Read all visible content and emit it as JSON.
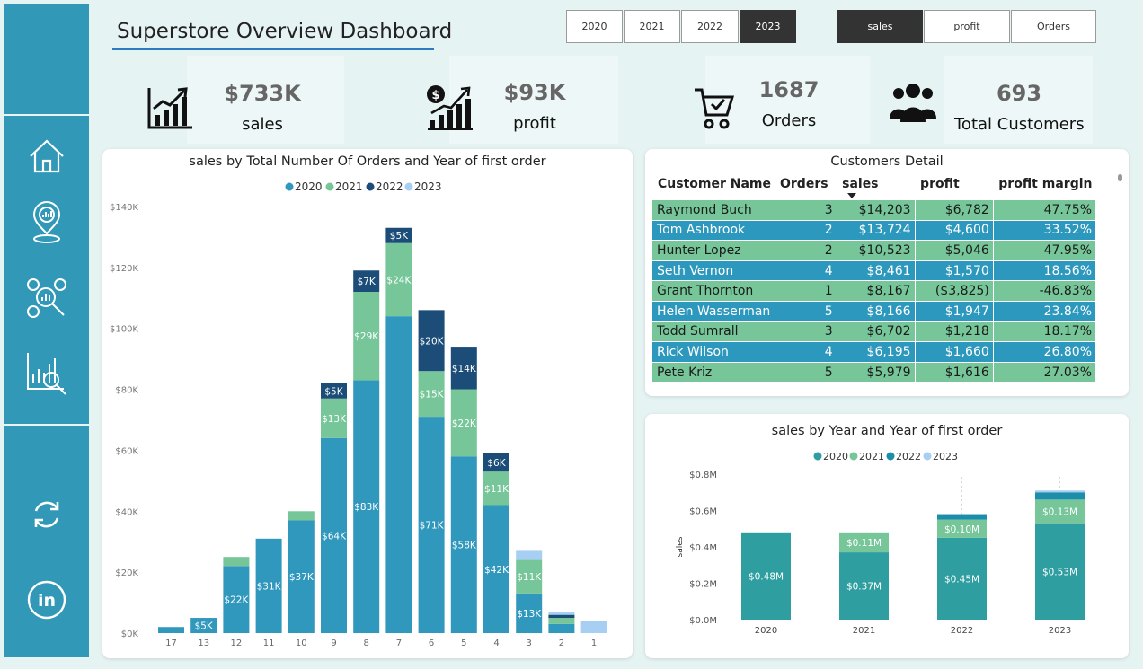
{
  "header": {
    "title": "Superstore Overview Dashboard"
  },
  "year_filter": [
    {
      "label": "2020",
      "selected": false
    },
    {
      "label": "2021",
      "selected": false
    },
    {
      "label": "2022",
      "selected": false
    },
    {
      "label": "2023",
      "selected": true
    }
  ],
  "measure_filter": [
    {
      "label": "sales",
      "selected": true
    },
    {
      "label": "profit",
      "selected": false
    },
    {
      "label": "Orders",
      "selected": false
    }
  ],
  "kpis": {
    "sales": {
      "value": "$733K",
      "label": "sales"
    },
    "profit": {
      "value": "$93K",
      "label": "profit"
    },
    "orders": {
      "value": "1687",
      "label": "Orders"
    },
    "customers": {
      "value": "693",
      "label": "Total Customers"
    }
  },
  "icons": {
    "home": "home-icon",
    "map": "map-pin-icon",
    "customers": "customer-analysis-icon",
    "report": "report-search-icon",
    "refresh": "refresh-icon",
    "linkedin": "linkedin-icon"
  },
  "colors": {
    "2020": "#3198bd",
    "2021": "#76c69a",
    "2022": "#1c4d78",
    "2023": "#a7cff3",
    "y2020_small": "#2f9ea0",
    "y2022_small": "#1d8eaa",
    "sidebar": "#3198b8"
  },
  "chart_main": {
    "title": "sales by Total Number Of Orders and Year of first order",
    "legend": [
      "2020",
      "2021",
      "2022",
      "2023"
    ],
    "y_ticks": [
      "$0K",
      "$20K",
      "$40K",
      "$60K",
      "$80K",
      "$100K",
      "$120K",
      "$140K"
    ],
    "ylim": [
      0,
      140
    ]
  },
  "chart_small": {
    "title": "sales by Year and Year of first order",
    "legend": [
      "2020",
      "2021",
      "2022",
      "2023"
    ],
    "ylabel": "sales",
    "y_ticks": [
      "$0.0M",
      "$0.2M",
      "$0.4M",
      "$0.6M",
      "$0.8M"
    ],
    "ylim": [
      0,
      0.8
    ]
  },
  "chart_data": [
    {
      "type": "bar",
      "stacked": true,
      "title": "sales by Total Number Of Orders and Year of first order",
      "xlabel": "",
      "ylabel": "",
      "ylim": [
        0,
        140
      ],
      "grid": false,
      "legend_position": "top",
      "categories": [
        "17",
        "13",
        "12",
        "11",
        "10",
        "9",
        "8",
        "7",
        "6",
        "5",
        "4",
        "3",
        "2",
        "1"
      ],
      "series": [
        {
          "name": "2020",
          "values": [
            2,
            5,
            22,
            31,
            37,
            64,
            83,
            104,
            71,
            58,
            42,
            13,
            3,
            0
          ],
          "labels": [
            "",
            "$5K",
            "$22K",
            "$31K",
            "$37K",
            "$64K",
            "$83K",
            "",
            "$71K",
            "$58K",
            "$42K",
            "$13K",
            "",
            ""
          ]
        },
        {
          "name": "2021",
          "values": [
            0,
            0,
            3,
            0,
            3,
            13,
            29,
            24,
            15,
            22,
            11,
            11,
            2,
            0
          ],
          "labels": [
            "",
            "",
            "",
            "",
            "",
            "$13K",
            "$29K",
            "$24K",
            "$15K",
            "$22K",
            "$11K",
            "$11K",
            "",
            ""
          ]
        },
        {
          "name": "2022",
          "values": [
            0,
            0,
            0,
            0,
            0,
            5,
            7,
            5,
            20,
            14,
            6,
            0,
            1,
            0
          ],
          "labels": [
            "",
            "",
            "",
            "",
            "",
            "$5K",
            "$7K",
            "$5K",
            "$20K",
            "$14K",
            "$6K",
            "",
            "",
            ""
          ]
        },
        {
          "name": "2023",
          "values": [
            0,
            0,
            0,
            0,
            0,
            0,
            0,
            0,
            0,
            0,
            0,
            3,
            1,
            4
          ],
          "labels": [
            "",
            "",
            "",
            "",
            "",
            "",
            "",
            "",
            "",
            "",
            "",
            "",
            "",
            ""
          ]
        }
      ]
    },
    {
      "type": "bar",
      "stacked": true,
      "title": "sales by Year and Year of first order",
      "xlabel": "",
      "ylabel": "sales",
      "ylim": [
        0,
        0.8
      ],
      "grid": false,
      "legend_position": "top",
      "categories": [
        "2020",
        "2021",
        "2022",
        "2023"
      ],
      "series": [
        {
          "name": "2020",
          "values": [
            0.48,
            0.37,
            0.45,
            0.53
          ],
          "labels": [
            "$0.48M",
            "$0.37M",
            "$0.45M",
            "$0.53M"
          ]
        },
        {
          "name": "2021",
          "values": [
            0,
            0.11,
            0.1,
            0.13
          ],
          "labels": [
            "",
            "$0.11M",
            "$0.10M",
            "$0.13M"
          ]
        },
        {
          "name": "2022",
          "values": [
            0,
            0,
            0.03,
            0.04
          ],
          "labels": [
            "",
            "",
            "",
            ""
          ]
        },
        {
          "name": "2023",
          "values": [
            0,
            0,
            0,
            0.01
          ],
          "labels": [
            "",
            "",
            "",
            ""
          ]
        }
      ]
    }
  ],
  "customers_table": {
    "title": "Customers Detail",
    "columns": [
      "Customer Name",
      "Orders",
      "sales",
      "profit",
      "profit margin"
    ],
    "rows": [
      [
        "Raymond Buch",
        "3",
        "$14,203",
        "$6,782",
        "47.75%"
      ],
      [
        "Tom Ashbrook",
        "2",
        "$13,724",
        "$4,600",
        "33.52%"
      ],
      [
        "Hunter Lopez",
        "2",
        "$10,523",
        "$5,046",
        "47.95%"
      ],
      [
        "Seth Vernon",
        "4",
        "$8,461",
        "$1,570",
        "18.56%"
      ],
      [
        "Grant Thornton",
        "1",
        "$8,167",
        "($3,825)",
        "-46.83%"
      ],
      [
        "Helen Wasserman",
        "5",
        "$8,166",
        "$1,947",
        "23.84%"
      ],
      [
        "Todd Sumrall",
        "3",
        "$6,702",
        "$1,218",
        "18.17%"
      ],
      [
        "Rick Wilson",
        "4",
        "$6,195",
        "$1,660",
        "26.80%"
      ],
      [
        "Pete Kriz",
        "5",
        "$5,979",
        "$1,616",
        "27.03%"
      ]
    ]
  }
}
